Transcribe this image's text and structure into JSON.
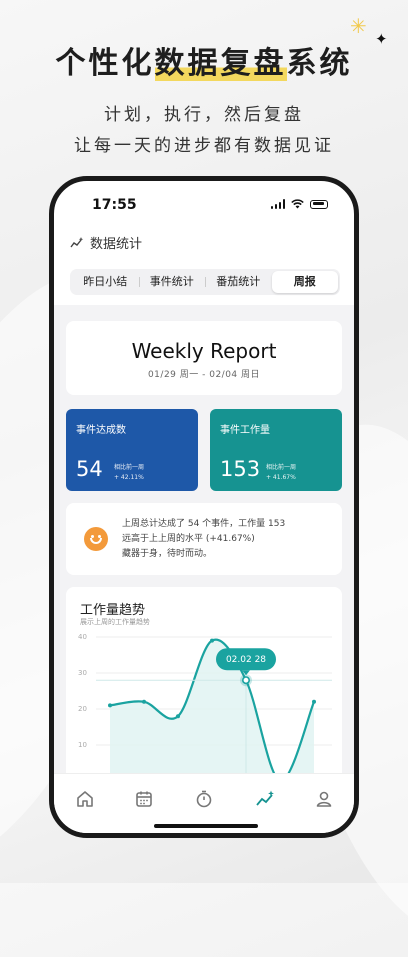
{
  "promo": {
    "title_a": "个性化",
    "title_b": "数据复盘",
    "title_c": "系统",
    "line1": "计划，执行，然后复盘",
    "line2": "让每一天的进步都有数据见证"
  },
  "status_bar": {
    "time": "17:55"
  },
  "header": {
    "title": "数据统计"
  },
  "tabs": [
    "昨日小结",
    "事件统计",
    "番茄统计",
    "周报"
  ],
  "active_tab": "周报",
  "report": {
    "title": "Weekly Report",
    "range": "01/29 周一  -  02/04 周日"
  },
  "stats": [
    {
      "label": "事件达成数",
      "value": "54",
      "compare_label": "相比前一周",
      "compare_value": "+ 42.11%"
    },
    {
      "label": "事件工作量",
      "value": "153",
      "compare_label": "相比前一周",
      "compare_value": "+ 41.67%"
    }
  ],
  "summary": {
    "line1": "上周总计达成了 54 个事件，工作量 153",
    "line2": "远高于上上周的水平 (+41.67%)",
    "line3": "藏器于身，待时而动。"
  },
  "trend": {
    "title": "工作量趋势",
    "subtitle": "展示上周的工作量趋势",
    "tooltip": "02.02  28"
  },
  "chart_data": {
    "type": "area",
    "title": "工作量趋势",
    "subtitle": "展示上周的工作量趋势",
    "y_ticks": [
      "40",
      "30",
      "20",
      "10"
    ],
    "ylim": [
      0,
      40
    ],
    "x_count": 7,
    "values": [
      21,
      22,
      18,
      39,
      28,
      0,
      22
    ],
    "highlight_index": 4,
    "highlight_label": "02.02",
    "highlight_value": 28,
    "colors": {
      "line": "#1aa3a0",
      "fill": "#dff2f1",
      "tooltip": "#1aa3a0"
    }
  },
  "tabbar": [
    "home-icon",
    "calendar-icon",
    "timer-icon",
    "stats-icon",
    "profile-icon"
  ],
  "active_tabbar": "stats-icon"
}
